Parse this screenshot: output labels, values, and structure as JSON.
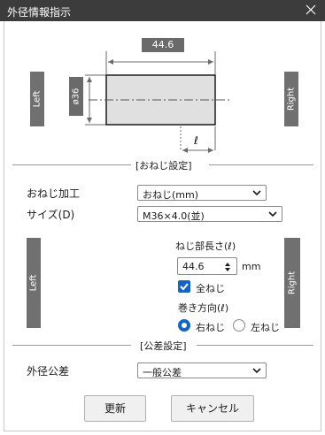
{
  "window": {
    "title": "外径情報指示",
    "close_icon": "close-icon"
  },
  "diagram": {
    "length_value": "44.6",
    "diameter_label": "ø36",
    "thread_length_symbol": "ℓ",
    "left_tab": "Left",
    "right_tab": "Right"
  },
  "thread_section": {
    "header": "[おねじ設定]",
    "process_label": "おねじ加工",
    "process_value": "おねじ(mm)",
    "size_label": "サイズ(D)",
    "size_value": "M36×4.0(並)",
    "left_tab": "Left",
    "right_tab": "Right",
    "thread_length_label": "ねじ部長さ(ℓ)",
    "thread_length_value": "44.6",
    "thread_length_unit": "mm",
    "full_thread_label": "全ねじ",
    "full_thread_checked": true,
    "winding_label": "巻き方向(ℓ)",
    "right_hand_label": "右ねじ",
    "left_hand_label": "左ねじ",
    "winding_selected": "右ねじ"
  },
  "tolerance_section": {
    "header": "[公差設定]",
    "od_tolerance_label": "外径公差",
    "od_tolerance_value": "一般公差"
  },
  "buttons": {
    "update": "更新",
    "cancel": "キャンセル"
  },
  "colors": {
    "titlebar": "#3c3c3c",
    "tab": "#707070",
    "accent": "#1565c0"
  }
}
